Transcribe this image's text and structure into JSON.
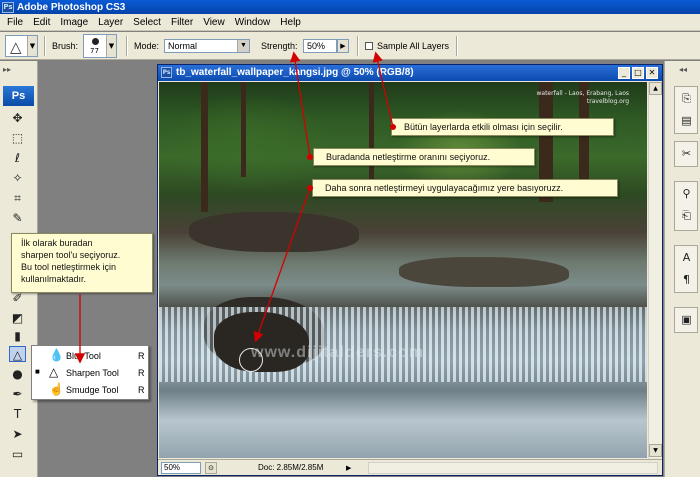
{
  "window": {
    "title": "Adobe Photoshop CS3",
    "app_badge": "Ps"
  },
  "menu": [
    "File",
    "Edit",
    "Image",
    "Layer",
    "Select",
    "Filter",
    "View",
    "Window",
    "Help"
  ],
  "options": {
    "brush_label": "Brush:",
    "brush_size": "77",
    "mode_label": "Mode:",
    "mode_value": "Normal",
    "strength_label": "Strength:",
    "strength_value": "50%",
    "sample_all_layers_label": "Sample All Layers",
    "sample_all_layers_checked": false
  },
  "toolbox": {
    "logo": "Ps"
  },
  "flyout": [
    {
      "label": "Blur Tool",
      "key": "R",
      "selected": false,
      "icon": "blur-drop-icon"
    },
    {
      "label": "Sharpen Tool",
      "key": "R",
      "selected": true,
      "icon": "sharpen-triangle-icon"
    },
    {
      "label": "Smudge Tool",
      "key": "R",
      "selected": false,
      "icon": "smudge-hand-icon"
    }
  ],
  "document": {
    "title": "tb_waterfall_wallpaper_kangsi.jpg @ 50% (RGB/8)",
    "doc_badge": "Ps",
    "zoom": "50%",
    "doc_size": "Doc: 2.85M/2.85M",
    "photo_credit_line1": "waterfall - Laos, Erabang, Laos",
    "photo_credit_line2": "travelblog.org",
    "watermark": "www.dijitalders.com"
  },
  "callouts": {
    "c1": "Bütün layerlarda etkili olması için seçilir.",
    "c2": "Buradanda netleştirme oranını seçiyoruz.",
    "c3": "Daha sonra netleştirmeyi uygulayacağımız yere basıyoruzz.",
    "c4_lines": [
      "İlk olarak buradan",
      "sharpen tool'u seçiyoruz.",
      "Bu tool netleştirmek için",
      "kullanılmaktadır."
    ]
  },
  "colors": {
    "annotation_red": "#d40000",
    "callout_bg": "#fffcd2",
    "titlebar_blue": "#0a5bd6"
  }
}
